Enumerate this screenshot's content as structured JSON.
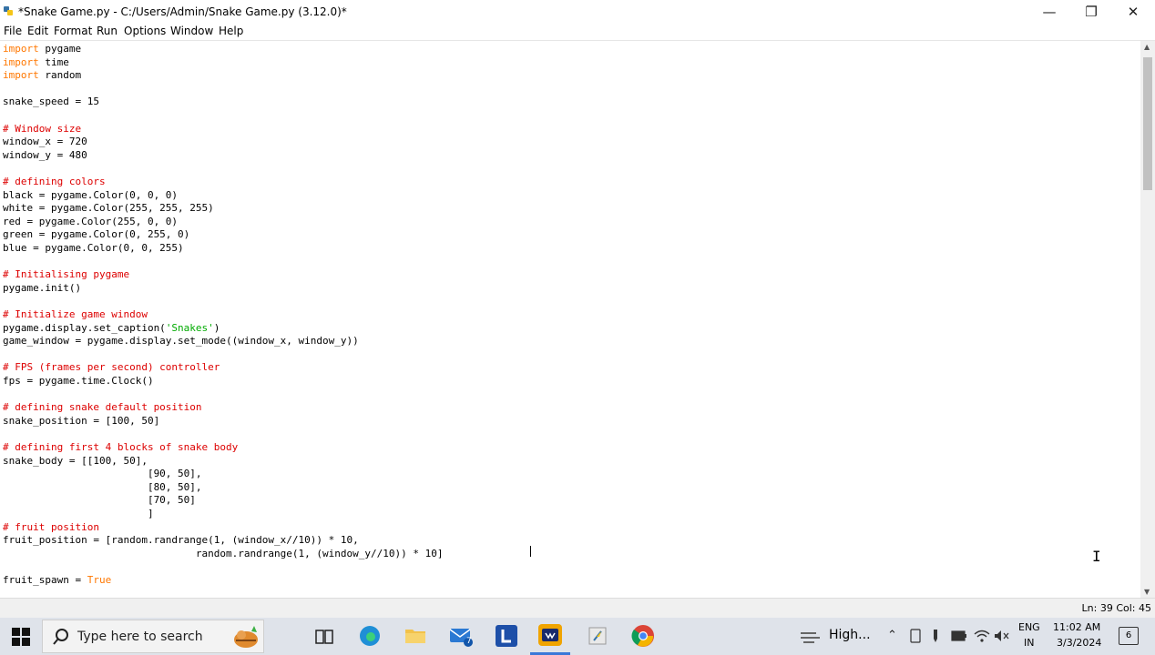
{
  "window": {
    "title": "*Snake Game.py - C:/Users/Admin/Snake Game.py (3.12.0)*",
    "minimize_glyph": "—",
    "restore_glyph": "❐",
    "close_glyph": "✕"
  },
  "menu": [
    "File",
    "Edit",
    "Format",
    "Run",
    "Options",
    "Window",
    "Help"
  ],
  "code_lines": [
    [
      [
        "kw",
        "import"
      ],
      [
        "",
        " pygame"
      ]
    ],
    [
      [
        "kw",
        "import"
      ],
      [
        "",
        " time"
      ]
    ],
    [
      [
        "kw",
        "import"
      ],
      [
        "",
        " random"
      ]
    ],
    [],
    [
      [
        "",
        "snake_speed = 15"
      ]
    ],
    [],
    [
      [
        "cm",
        "# Window size"
      ]
    ],
    [
      [
        "",
        "window_x = 720"
      ]
    ],
    [
      [
        "",
        "window_y = 480"
      ]
    ],
    [],
    [
      [
        "cm",
        "# defining colors"
      ]
    ],
    [
      [
        "",
        "black = pygame.Color(0, 0, 0)"
      ]
    ],
    [
      [
        "",
        "white = pygame.Color(255, 255, 255)"
      ]
    ],
    [
      [
        "",
        "red = pygame.Color(255, 0, 0)"
      ]
    ],
    [
      [
        "",
        "green = pygame.Color(0, 255, 0)"
      ]
    ],
    [
      [
        "",
        "blue = pygame.Color(0, 0, 255)"
      ]
    ],
    [],
    [
      [
        "cm",
        "# Initialising pygame"
      ]
    ],
    [
      [
        "",
        "pygame.init()"
      ]
    ],
    [],
    [
      [
        "cm",
        "# Initialize game window"
      ]
    ],
    [
      [
        "",
        "pygame.display.set_caption("
      ],
      [
        "st",
        "'Snakes'"
      ],
      [
        "",
        ")"
      ]
    ],
    [
      [
        "",
        "game_window = pygame.display.set_mode((window_x, window_y))"
      ]
    ],
    [],
    [
      [
        "cm",
        "# FPS (frames per second) controller"
      ]
    ],
    [
      [
        "",
        "fps = pygame.time.Clock()"
      ]
    ],
    [],
    [
      [
        "cm",
        "# defining snake default position"
      ]
    ],
    [
      [
        "",
        "snake_position = [100, 50]"
      ]
    ],
    [],
    [
      [
        "cm",
        "# defining first 4 blocks of snake body"
      ]
    ],
    [
      [
        "",
        "snake_body = [[100, 50],"
      ]
    ],
    [
      [
        "",
        "                        [90, 50],"
      ]
    ],
    [
      [
        "",
        "                        [80, 50],"
      ]
    ],
    [
      [
        "",
        "                        [70, 50]"
      ]
    ],
    [
      [
        "",
        "                        ]"
      ]
    ],
    [
      [
        "cm",
        "# fruit position"
      ]
    ],
    [
      [
        "",
        "fruit_position = [random.randrange(1, (window_x//10)) * 10,"
      ]
    ],
    [
      [
        "",
        "                                random.randrange(1, (window_y//10)) * 10]"
      ]
    ],
    [],
    [
      [
        "",
        "fruit_spawn = "
      ],
      [
        "kw",
        "True"
      ]
    ]
  ],
  "status": {
    "position": "Ln: 39  Col: 45"
  },
  "taskbar": {
    "search_placeholder": "Type here to search",
    "mail_badge": "7",
    "weather": "High...",
    "lang_line1": "ENG",
    "lang_line2": "IN",
    "time": "11:02 AM",
    "date": "3/3/2024",
    "notifications": "6"
  },
  "colors": {
    "keyword": "#ff7700",
    "comment": "#dd0000",
    "string": "#00aa00",
    "taskbar": "#dfe3ea"
  }
}
